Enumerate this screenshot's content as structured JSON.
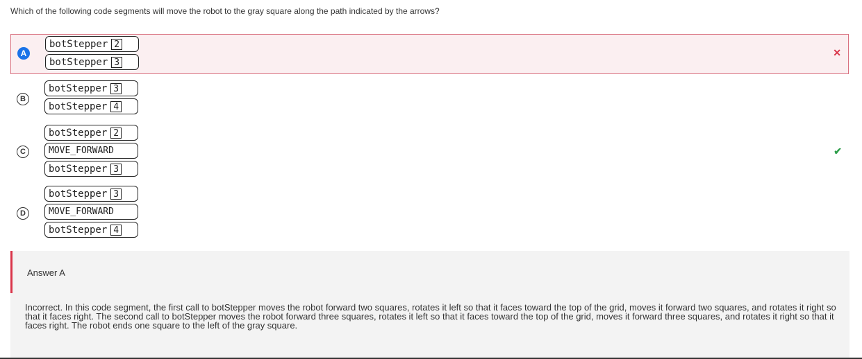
{
  "question": "Which of the following code segments will move the robot to the gray square along the path indicated by the arrows?",
  "options": [
    {
      "letter": "A",
      "blocks": [
        {
          "name": "botStepper",
          "arg": "2"
        },
        {
          "name": "botStepper",
          "arg": "3"
        }
      ],
      "mark": "✕"
    },
    {
      "letter": "B",
      "blocks": [
        {
          "name": "botStepper",
          "arg": "3"
        },
        {
          "name": "botStepper",
          "arg": "4"
        }
      ]
    },
    {
      "letter": "C",
      "blocks": [
        {
          "name": "botStepper",
          "arg": "2"
        },
        {
          "name": "MOVE_FORWARD"
        },
        {
          "name": "botStepper",
          "arg": "3"
        }
      ],
      "mark": "✔"
    },
    {
      "letter": "D",
      "blocks": [
        {
          "name": "botStepper",
          "arg": "3"
        },
        {
          "name": "MOVE_FORWARD"
        },
        {
          "name": "botStepper",
          "arg": "4"
        }
      ]
    }
  ],
  "explanation": {
    "title": "Answer A",
    "text": "Incorrect. In this code segment, the first call to botStepper moves the robot forward two squares, rotates it left so that it faces toward the top of the grid, moves it forward two squares, and rotates it right so that it faces right. The second call to botStepper moves the robot forward three squares, rotates it left so that it faces toward the top of the grid, moves it forward three squares, and rotates it right so that it faces right. The robot ends one square to the left of the gray square."
  },
  "colors": {
    "selected": "#1a73e8",
    "incorrect": "#d93449",
    "correct": "#2e9e4b"
  }
}
